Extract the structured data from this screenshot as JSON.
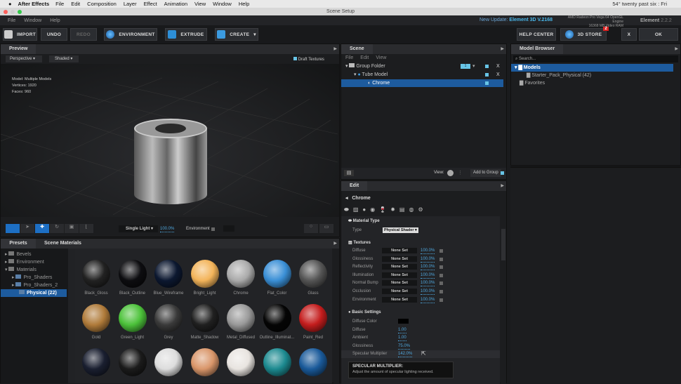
{
  "mac_menu": {
    "app": "After Effects",
    "items": [
      "File",
      "Edit",
      "Composition",
      "Layer",
      "Effect",
      "Animation",
      "View",
      "Window",
      "Help"
    ],
    "status": "54°  twenty past six : Fri"
  },
  "window_title": "Scene Setup",
  "app_menu": [
    "File",
    "Window",
    "Help"
  ],
  "update": {
    "label": "New Update:",
    "version": "Element 3D V.2168"
  },
  "gpu": {
    "line1": "AMD Radeon Pro Vega 64 OpenGL Engine",
    "line2": "16368 MB Video RAM"
  },
  "version": {
    "name": "Element",
    "number": "2.2.2"
  },
  "toolbar": {
    "import": "IMPORT",
    "undo": "UNDO",
    "redo": "REDO",
    "environment": "ENVIRONMENT",
    "extrude": "EXTRUDE",
    "create": "CREATE",
    "help": "HELP CENTER",
    "store": "3D STORE",
    "store_badge": "2",
    "close": "X",
    "ok": "OK"
  },
  "preview": {
    "tab": "Preview",
    "camera": "Perspective",
    "shading": "Shaded",
    "draft": "Draft Textures",
    "stats": [
      "Model:  Multiple Models",
      "Vertices:  1920",
      "Faces:  960"
    ],
    "light": "Single Light",
    "light_pct": "100.0%",
    "env": "Environment"
  },
  "scene": {
    "tab": "Scene",
    "menu": [
      "File",
      "Edit",
      "View"
    ],
    "items": [
      {
        "label": "Group Folder",
        "group": "1",
        "x": "X"
      },
      {
        "label": "Tube Model",
        "x": "X"
      },
      {
        "label": "Chrome"
      }
    ],
    "view": "View:",
    "add": "Add to Group"
  },
  "edit": {
    "tab": "Edit",
    "title": "Chrome",
    "material_type": "Material Type",
    "type_label": "Type",
    "type_value": "Physical Shader",
    "textures_title": "Textures",
    "textures": [
      {
        "name": "Diffuse",
        "value": "None Set",
        "pct": "100.0%"
      },
      {
        "name": "Glossiness",
        "value": "None Set",
        "pct": "100.0%"
      },
      {
        "name": "Reflectivity",
        "value": "None Set",
        "pct": "100.0%"
      },
      {
        "name": "Illumination",
        "value": "None Set",
        "pct": "100.0%"
      },
      {
        "name": "Normal Bump",
        "value": "None Set",
        "pct": "100.0%"
      },
      {
        "name": "Occlusion",
        "value": "None Set",
        "pct": "100.0%"
      },
      {
        "name": "Environment",
        "value": "None Set",
        "pct": "100.0%"
      }
    ],
    "basic_title": "Basic Settings",
    "basic": [
      {
        "name": "Diffuse Color",
        "value": ""
      },
      {
        "name": "Diffuse",
        "value": "1.00"
      },
      {
        "name": "Ambient",
        "value": "1.00"
      },
      {
        "name": "Glossiness",
        "value": "75.0%"
      },
      {
        "name": "Specular Multiplier",
        "value": "142.0%"
      }
    ],
    "tooltip_title": "SPECULAR MULTIPLIER:",
    "tooltip_text": "Adjust the amount of specular lighting received."
  },
  "model_browser": {
    "tab": "Model Browser",
    "search_placeholder": "Search...",
    "items": [
      "Models",
      "Starter_Pack_Physical (42)",
      "Favorites"
    ]
  },
  "presets": {
    "tabs": [
      "Presets",
      "Scene Materials"
    ],
    "tree": [
      "Bevels",
      "Environment",
      "Materials",
      "Pro_Shaders",
      "Pro_Shaders_2",
      "Physical (22)"
    ],
    "materials": [
      {
        "name": "Black_Gloss",
        "color": "#222"
      },
      {
        "name": "Black_Outline",
        "color": "#0d0d10"
      },
      {
        "name": "Blue_Wireframe",
        "color": "#0c1830"
      },
      {
        "name": "Bright_Light",
        "color": "#f3b45a"
      },
      {
        "name": "Chrome",
        "color": "#aaa"
      },
      {
        "name": "Flat_Color",
        "color": "#3a8fd6"
      },
      {
        "name": "Glass",
        "color": "#555"
      },
      {
        "name": "Gold",
        "color": "#b07b3a"
      },
      {
        "name": "Green_Light",
        "color": "#4cc23a"
      },
      {
        "name": "Grey",
        "color": "#3a3a3a"
      },
      {
        "name": "Matte_Shadow",
        "color": "#202020"
      },
      {
        "name": "Metal_Diffused",
        "color": "#999"
      },
      {
        "name": "Outline_Illuminat...",
        "color": "#050505"
      },
      {
        "name": "Paint_Red",
        "color": "#c41d1d"
      },
      {
        "name": "",
        "color": "#1a1f30"
      },
      {
        "name": "",
        "color": "#1b1b1b"
      },
      {
        "name": "",
        "color": "#ddd"
      },
      {
        "name": "",
        "color": "#d9966a"
      },
      {
        "name": "",
        "color": "#e8e4e0"
      },
      {
        "name": "",
        "color": "#1c8a90"
      },
      {
        "name": "",
        "color": "#1a5a9a"
      }
    ]
  }
}
